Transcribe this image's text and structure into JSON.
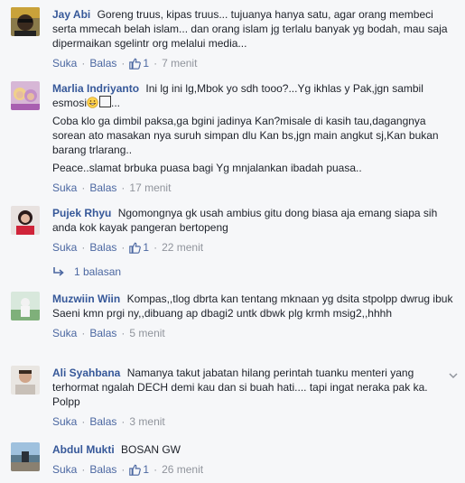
{
  "labels": {
    "like": "Suka",
    "reply": "Balas",
    "sep": "·"
  },
  "colors": {
    "link": "#365899",
    "action": "#4b67a1",
    "meta": "#90949c",
    "bg": "#f6f7f9"
  },
  "comments": [
    {
      "author": "Jay Abi",
      "text": "Goreng truus, kipas truus... tujuanya hanya satu, agar orang membeci serta mmecah belah islam... dan orang islam jg terlalu banyak yg bodah, mau saja dipermaikan sgelintr org melalui media...",
      "like_count": "1",
      "time": "7 menit"
    },
    {
      "author": "Marlia Indriyanto",
      "text_a": "Ini lg ini lg,Mbok yo sdh tooo?...Yg ikhlas y Pak,jgn sambil esmosi",
      "text_a_tail": "...",
      "text_b": "Coba klo ga dimbil paksa,ga bgini jadinya Kan?misale di kasih tau,dagangnya sorean ato masakan nya suruh simpan dlu Kan bs,jgn main angkut sj,Kan bukan barang trlarang..",
      "text_c": "Peace..slamat brbuka puasa bagi Yg mnjalankan ibadah puasa..",
      "time": "17 menit"
    },
    {
      "author": "Pujek Rhyu",
      "text": "Ngomongnya gk usah ambius gitu dong biasa aja emang siapa sih anda kok kayak pangeran bertopeng",
      "like_count": "1",
      "time": "22 menit",
      "replies": "1 balasan"
    },
    {
      "author": "Muzwiin Wiin",
      "text": "Kompas,,tlog dbrta kan tentang mknaan yg dsita stpolpp dwrug ibuk Saeni kmn prgi ny,,dibuang ap dbagi2 untk dbwk plg krmh msig2,,hhhh",
      "time": "5 menit"
    },
    {
      "author": "Ali Syahbana",
      "text": "Namanya takut jabatan hilang perintah tuanku menteri yang terhormat ngalah DECH demi kau dan si buah hati.... tapi ingat neraka pak ka. Polpp",
      "time": "3 menit"
    },
    {
      "author": "Abdul Mukti",
      "text": "BOSAN GW",
      "like_count": "1",
      "time": "26 menit"
    }
  ]
}
